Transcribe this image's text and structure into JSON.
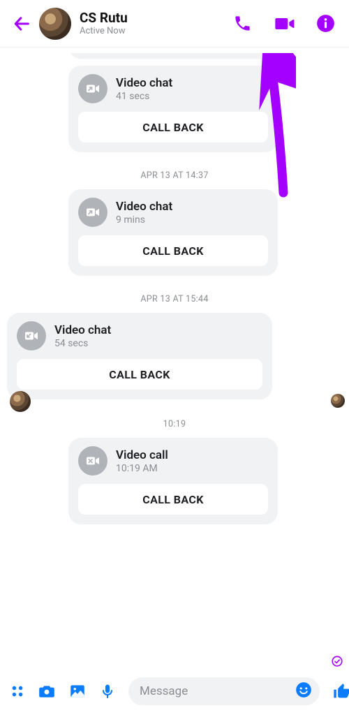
{
  "header": {
    "contact_name": "CS Rutu",
    "presence": "Active Now"
  },
  "timestamps": {
    "t1": "APR 13 AT 14:37",
    "t2": "APR 13 AT 15:44",
    "t3": "10:19"
  },
  "messages": {
    "m0": {
      "title": "Video chat",
      "sub": "41 secs",
      "btn": "CALL BACK"
    },
    "m1": {
      "title": "Video chat",
      "sub": "9 mins",
      "btn": "CALL BACK"
    },
    "m2": {
      "title": "Video chat",
      "sub": "54 secs",
      "btn": "CALL BACK"
    },
    "m3": {
      "title": "Video call",
      "sub": "10:19 AM",
      "btn": "CALL BACK"
    }
  },
  "composer": {
    "placeholder": "Message"
  }
}
